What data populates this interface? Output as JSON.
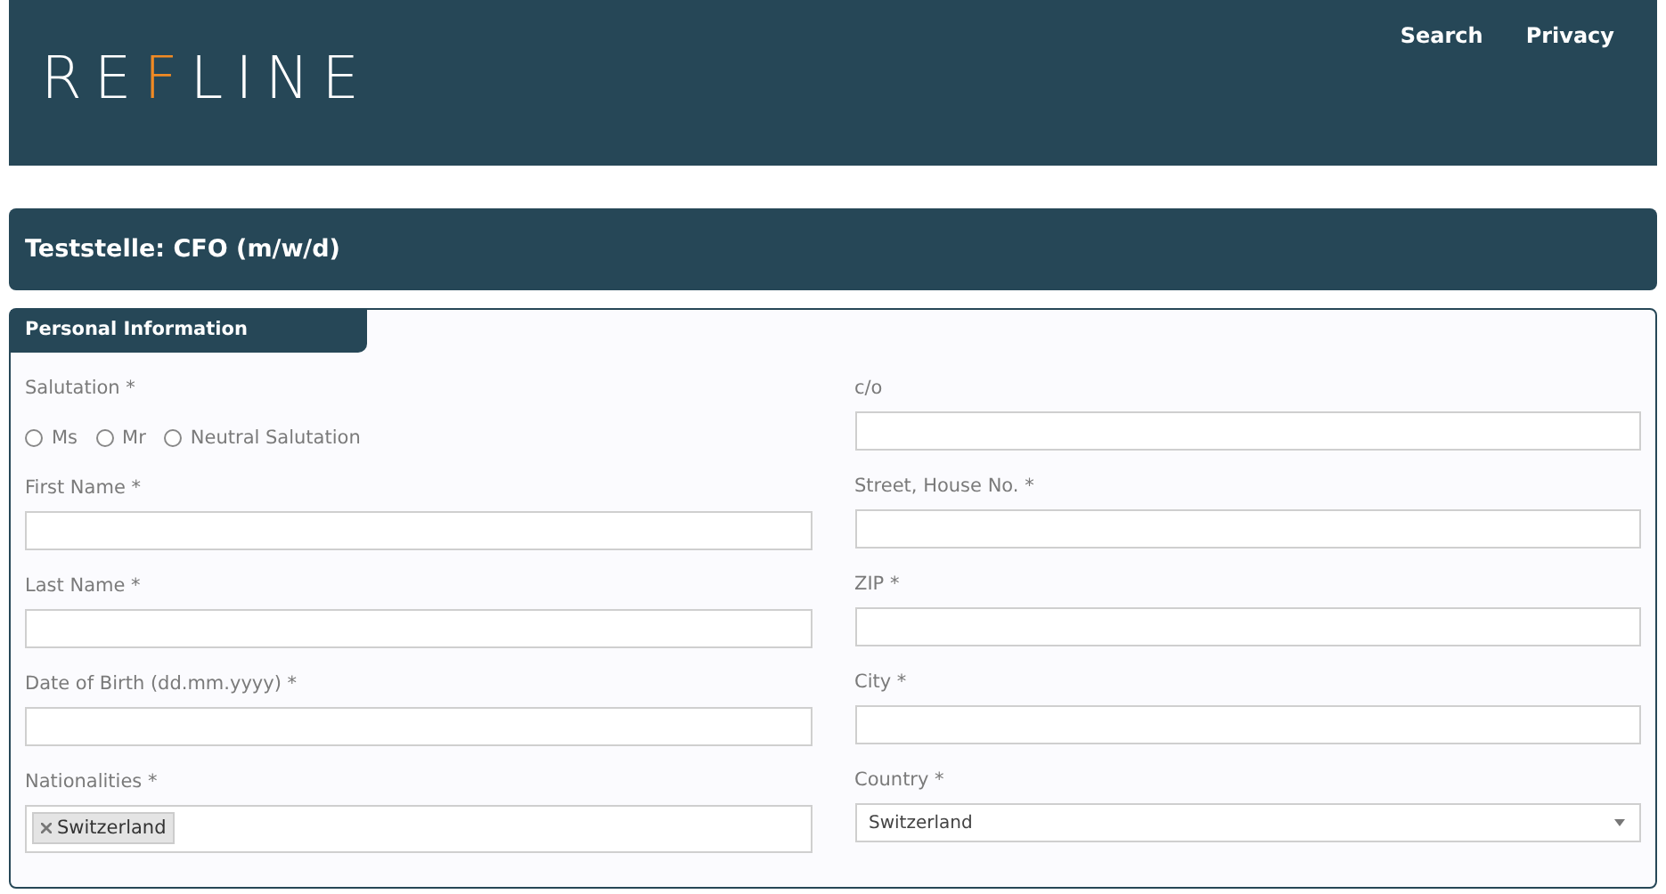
{
  "header": {
    "logo": {
      "before": "RE",
      "accent": "F",
      "after": "LINE"
    },
    "links": [
      "Search",
      "Privacy"
    ]
  },
  "job_title": "Teststelle: CFO (m/w/d)",
  "section": {
    "title": "Personal Information",
    "columns": [
      [
        {
          "kind": "radio",
          "label": "Salutation *",
          "options": [
            {
              "label": "Ms",
              "selected": false
            },
            {
              "label": "Mr",
              "selected": false
            },
            {
              "label": "Neutral Salutation",
              "selected": false
            }
          ]
        },
        {
          "kind": "text",
          "label": "First Name *"
        },
        {
          "kind": "text",
          "label": "Last Name *"
        },
        {
          "kind": "text",
          "label": "Date of Birth (dd.mm.yyyy) *"
        },
        {
          "kind": "tags",
          "label": "Nationalities *",
          "tags": [
            "Switzerland"
          ]
        }
      ],
      [
        {
          "kind": "text",
          "label": "c/o"
        },
        {
          "kind": "text",
          "label": "Street, House No. *"
        },
        {
          "kind": "text",
          "label": "ZIP *"
        },
        {
          "kind": "text",
          "label": "City *"
        },
        {
          "kind": "select",
          "label": "Country *",
          "value": "Switzerland"
        }
      ]
    ]
  }
}
